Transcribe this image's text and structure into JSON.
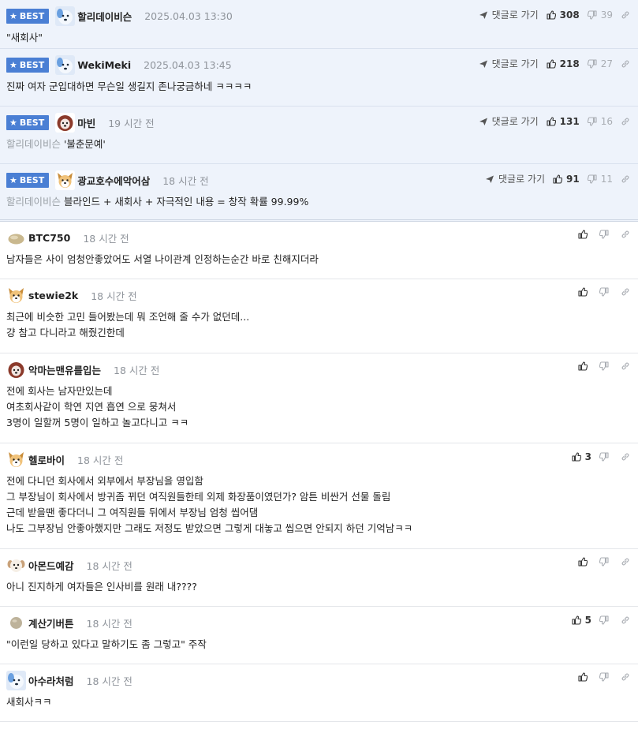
{
  "labels": {
    "best": "BEST",
    "reply_link": "댓글로 가기"
  },
  "comments": [
    {
      "best": true,
      "avatar": "blue-dog-avatar",
      "nick": "할리데이비슨",
      "time": "2025.04.03 13:30",
      "mention": "",
      "text": "\"새회사\"",
      "up": "308",
      "down": "39"
    },
    {
      "best": true,
      "avatar": "blue-dog-avatar",
      "nick": "WekiMeki",
      "time": "2025.04.03 13:45",
      "mention": "",
      "text": "진짜 여자 군입대하면 무슨일 생길지 존나궁금하네 ㅋㅋㅋㅋ",
      "up": "218",
      "down": "27"
    },
    {
      "best": true,
      "avatar": "poodle-avatar",
      "nick": "마빈",
      "time": "19 시간 전",
      "mention": "할리데이비슨",
      "text": "'불춘문예'",
      "up": "131",
      "down": "16"
    },
    {
      "best": true,
      "avatar": "shiba-avatar",
      "nick": "광교호수에악어삼",
      "time": "18 시간 전",
      "mention": "할리데이비슨",
      "text": "블라인드 + 새회사 + 자극적인 내용 = 창작 확률 99.99%",
      "up": "91",
      "down": "11"
    },
    {
      "best": false,
      "avatar": "pebble-avatar",
      "nick": "BTC750",
      "time": "18 시간 전",
      "mention": "",
      "text": "남자들은 사이 엄청안좋았어도 서열 나이관계 인정하는순간 바로 친해지더라",
      "up": "",
      "down": ""
    },
    {
      "best": false,
      "avatar": "shiba-avatar",
      "nick": "stewie2k",
      "time": "18 시간 전",
      "mention": "",
      "text": "최근에 비슷한 고민 들어봤는데 뭐 조언해 줄 수가 없던데...\n걍 참고 다니라고 해줬긴한데",
      "up": "",
      "down": ""
    },
    {
      "best": false,
      "avatar": "poodle-avatar",
      "nick": "악마는맨유를입는",
      "time": "18 시간 전",
      "mention": "",
      "text": "전에 회사는 남자만있는데\n여초회사같이 학연 지연 흡연 으로 뭉쳐서\n3명이 일할꺼 5명이 일하고 놀고다니고 ㅋㅋ",
      "up": "",
      "down": ""
    },
    {
      "best": false,
      "avatar": "shiba-avatar",
      "nick": "헬로바이",
      "time": "18 시간 전",
      "mention": "",
      "text": "전에 다니던 회사에서 외부에서 부장님을 영입함\n그 부장님이 회사에서 방귀좀 뀌던 여직원들한테 외제 화장품이였던가? 암튼 비싼거 선물 돌림\n근데 받을땐 좋다더니 그 여직원들 뒤에서 부장님 엄청 씹어댐\n나도 그부장님 안좋아했지만 그래도 저정도 받았으면 그렇게 대놓고 씹으면 안되지 하던 기억남ㅋㅋ",
      "up": "3",
      "down": ""
    },
    {
      "best": false,
      "avatar": "puppy-avatar",
      "nick": "아몬드예감",
      "time": "18 시간 전",
      "mention": "",
      "text": "아니 진지하게 여자들은 인사비를 원래 내????",
      "up": "",
      "down": ""
    },
    {
      "best": false,
      "avatar": "stone-avatar",
      "nick": "계산기버튼",
      "time": "18 시간 전",
      "mention": "",
      "text": "\"이런일 당하고 있다고 말하기도 좀 그렇고\" 주작",
      "up": "5",
      "down": ""
    },
    {
      "best": false,
      "avatar": "blue-dog-avatar",
      "nick": "아수라처럼",
      "time": "18 시간 전",
      "mention": "",
      "text": "새회사ㅋㅋ",
      "up": "",
      "down": ""
    }
  ]
}
